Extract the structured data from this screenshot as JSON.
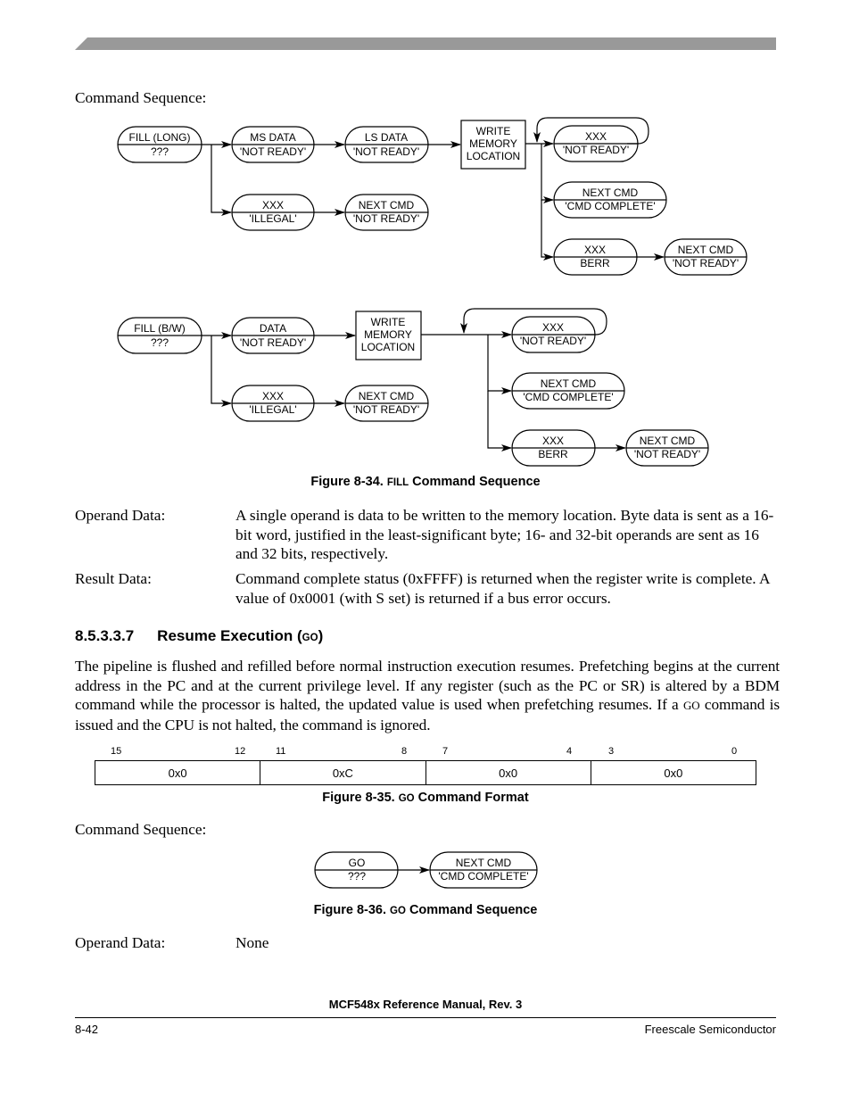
{
  "header": {
    "bar_color": "#999999"
  },
  "fill_section": {
    "command_sequence_label": "Command Sequence:",
    "diagram_long": {
      "start": {
        "top": "FILL (LONG)",
        "bottom": "???"
      },
      "ms_data": {
        "top": "MS DATA",
        "bottom": "'NOT READY'"
      },
      "ls_data": {
        "top": "LS DATA",
        "bottom": "'NOT READY'"
      },
      "write_box": [
        "WRITE",
        "MEMORY",
        "LOCATION"
      ],
      "xxx_not_ready": {
        "top": "XXX",
        "bottom": "'NOT READY'"
      },
      "next_cmd_complete": {
        "top": "NEXT CMD",
        "bottom": "'CMD COMPLETE'"
      },
      "xxx_berr": {
        "top": "XXX",
        "bottom": "BERR"
      },
      "next_cmd_not_ready_berr": {
        "top": "NEXT CMD",
        "bottom": "'NOT READY'"
      },
      "xxx_illegal": {
        "top": "XXX",
        "bottom": "'ILLEGAL'"
      },
      "next_cmd_not_ready_illegal": {
        "top": "NEXT CMD",
        "bottom": "'NOT READY'"
      }
    },
    "diagram_bw": {
      "start": {
        "top": "FILL (B/W)",
        "bottom": "???"
      },
      "data": {
        "top": "DATA",
        "bottom": "'NOT READY'"
      },
      "write_box": [
        "WRITE",
        "MEMORY",
        "LOCATION"
      ],
      "xxx_not_ready": {
        "top": "XXX",
        "bottom": "'NOT READY'"
      },
      "next_cmd_complete": {
        "top": "NEXT CMD",
        "bottom": "'CMD COMPLETE'"
      },
      "xxx_berr": {
        "top": "XXX",
        "bottom": "BERR"
      },
      "next_cmd_not_ready_berr": {
        "top": "NEXT CMD",
        "bottom": "'NOT READY'"
      },
      "xxx_illegal": {
        "top": "XXX",
        "bottom": "'ILLEGAL'"
      },
      "next_cmd_not_ready_illegal": {
        "top": "NEXT CMD",
        "bottom": "'NOT READY'"
      }
    },
    "figure_caption": {
      "prefix": "Figure 8-34. ",
      "keyword": "FILL",
      "suffix": " Command Sequence"
    },
    "operand_label": "Operand Data:",
    "operand_text": "A single operand is data to be written to the memory location. Byte data is sent as a 16-bit word, justified in the least-significant byte; 16- and 32-bit operands are sent as 16 and 32 bits, respectively.",
    "result_label": "Result Data:",
    "result_text": "Command complete status (0xFFFF) is returned when the register write is complete. A value of 0x0001 (with S set) is returned if a bus error occurs."
  },
  "go_section": {
    "heading_number": "8.5.3.3.7",
    "heading_title": "Resume Execution (",
    "heading_keyword": "GO",
    "heading_close": ")",
    "paragraph_part1": "The pipeline is flushed and refilled before normal instruction execution resumes. Prefetching begins at the current address in the PC and at the current privilege level. If any register (such as the PC or SR) is altered by a BDM command while the processor is halted, the updated value is used when prefetching resumes. If a ",
    "paragraph_keyword": "GO",
    "paragraph_part2": " command is issued and the CPU is not halted, the command is ignored.",
    "format": {
      "bit_labels": [
        "15",
        "12",
        "11",
        "8",
        "7",
        "4",
        "3",
        "0"
      ],
      "fields": [
        "0x0",
        "0xC",
        "0x0",
        "0x0"
      ]
    },
    "format_caption": {
      "prefix": "Figure 8-35. ",
      "keyword": "GO",
      "suffix": " Command Format"
    },
    "command_sequence_label": "Command Sequence:",
    "diagram": {
      "start": {
        "top": "GO",
        "bottom": "???"
      },
      "next": {
        "top": "NEXT CMD",
        "bottom": "'CMD COMPLETE'"
      }
    },
    "sequence_caption": {
      "prefix": "Figure 8-36. ",
      "keyword": "GO",
      "suffix": " Command Sequence"
    },
    "operand_label": "Operand Data:",
    "operand_text": "None"
  },
  "footer": {
    "manual_title": "MCF548x Reference Manual, Rev. 3",
    "page_number": "8-42",
    "company": "Freescale Semiconductor"
  }
}
